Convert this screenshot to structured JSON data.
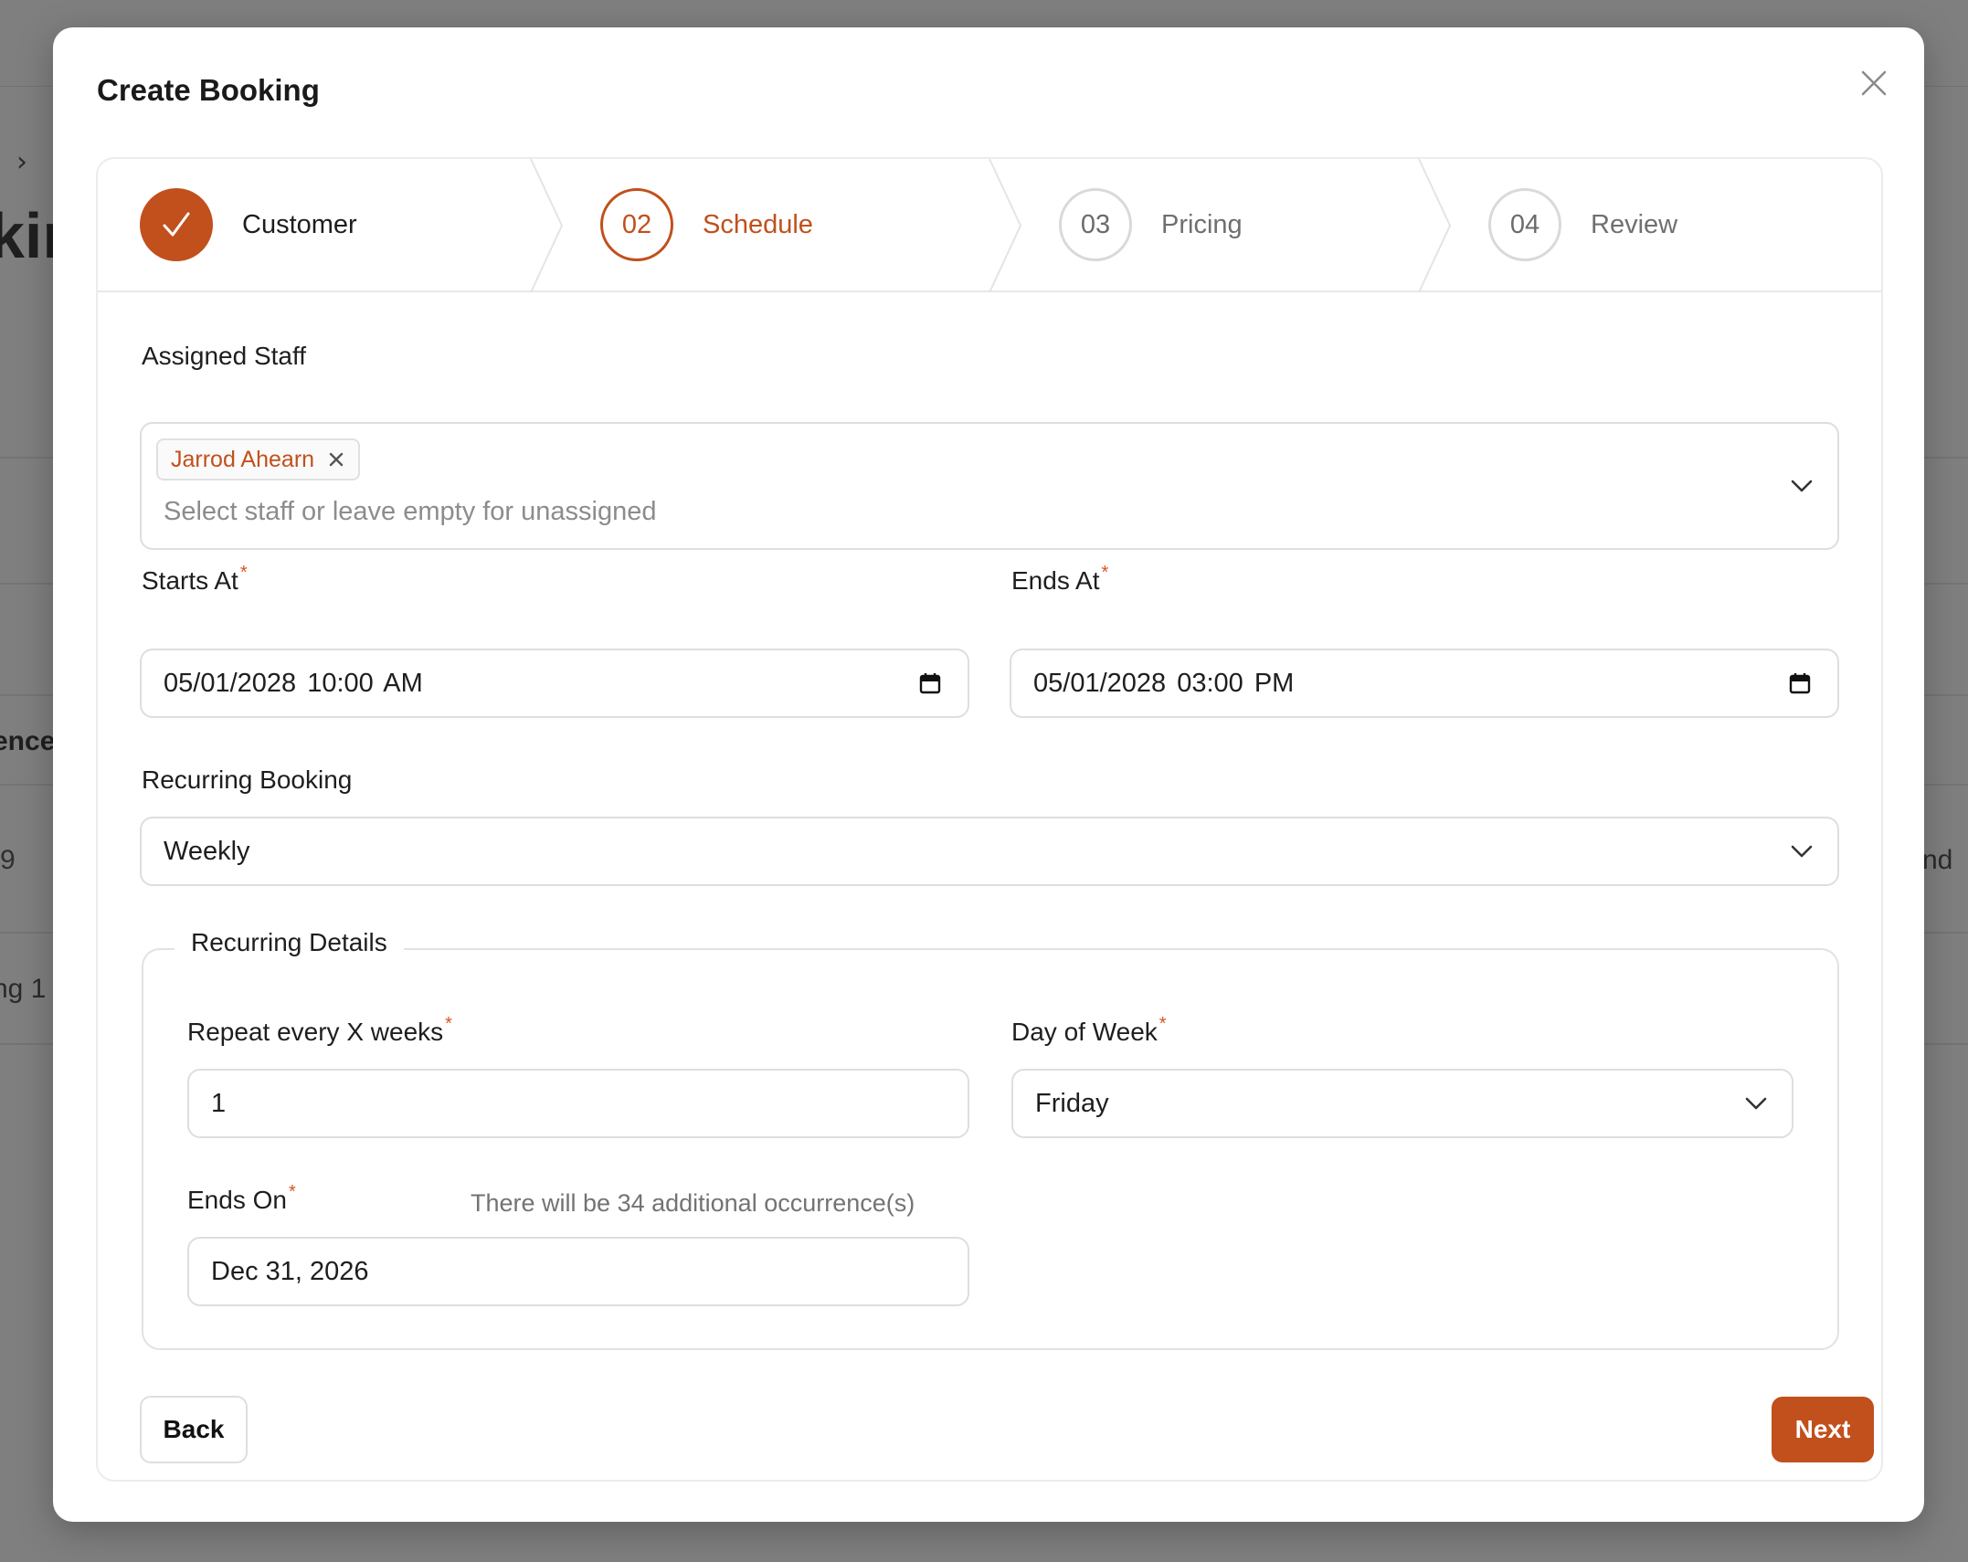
{
  "background": {
    "heading_fragment": "kin",
    "column_fragment": "ence",
    "cell_number": "9",
    "row_fragment": "ng 1",
    "right_fragment": "nd"
  },
  "modal": {
    "title": "Create Booking"
  },
  "stepper": {
    "steps": [
      {
        "number": "",
        "label": "Customer",
        "state": "done"
      },
      {
        "number": "02",
        "label": "Schedule",
        "state": "active"
      },
      {
        "number": "03",
        "label": "Pricing",
        "state": "pending"
      },
      {
        "number": "04",
        "label": "Review",
        "state": "pending"
      }
    ]
  },
  "form": {
    "assigned_staff": {
      "label": "Assigned Staff",
      "selected": [
        "Jarrod Ahearn"
      ],
      "placeholder": "Select staff or leave empty for unassigned"
    },
    "starts_at": {
      "label": "Starts At",
      "required_mark": "*",
      "value": "05/01/2028 10:00 AM"
    },
    "ends_at": {
      "label": "Ends At",
      "required_mark": "*",
      "value": "05/01/2028 03:00 PM"
    },
    "recurring_booking": {
      "label": "Recurring Booking",
      "value": "Weekly"
    },
    "recurring_details": {
      "legend": "Recurring Details",
      "repeat_every": {
        "label": "Repeat every X weeks",
        "required_mark": "*",
        "value": "1"
      },
      "day_of_week": {
        "label": "Day of Week",
        "required_mark": "*",
        "value": "Friday"
      },
      "ends_on": {
        "label": "Ends On",
        "required_mark": "*",
        "value": "Dec 31, 2026",
        "hint": "There will be 34 additional occurrence(s)"
      }
    }
  },
  "actions": {
    "back_label": "Back",
    "next_label": "Next"
  },
  "colors": {
    "accent": "#c1501c",
    "required": "#d9531e",
    "overlay": "#808080"
  }
}
